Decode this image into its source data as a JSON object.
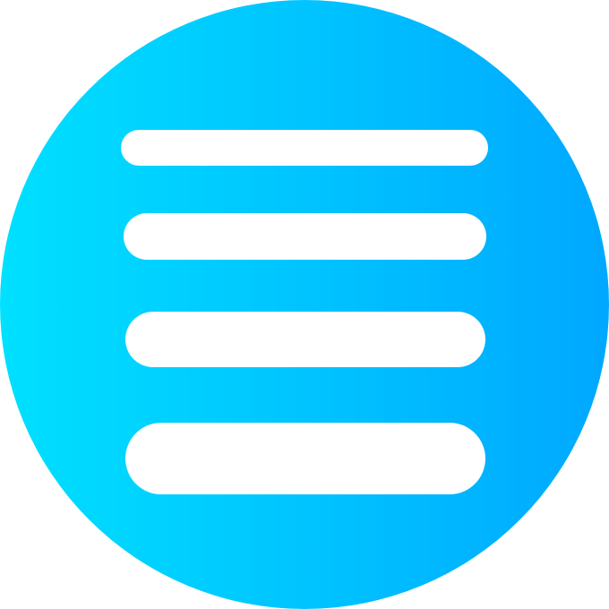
{
  "icon": {
    "name": "menu-lines-icon",
    "shape": "circle",
    "gradient": {
      "from": "#00E0FF",
      "to": "#00A8FF"
    },
    "line_color": "#FFFFFF",
    "line_count": 4
  }
}
